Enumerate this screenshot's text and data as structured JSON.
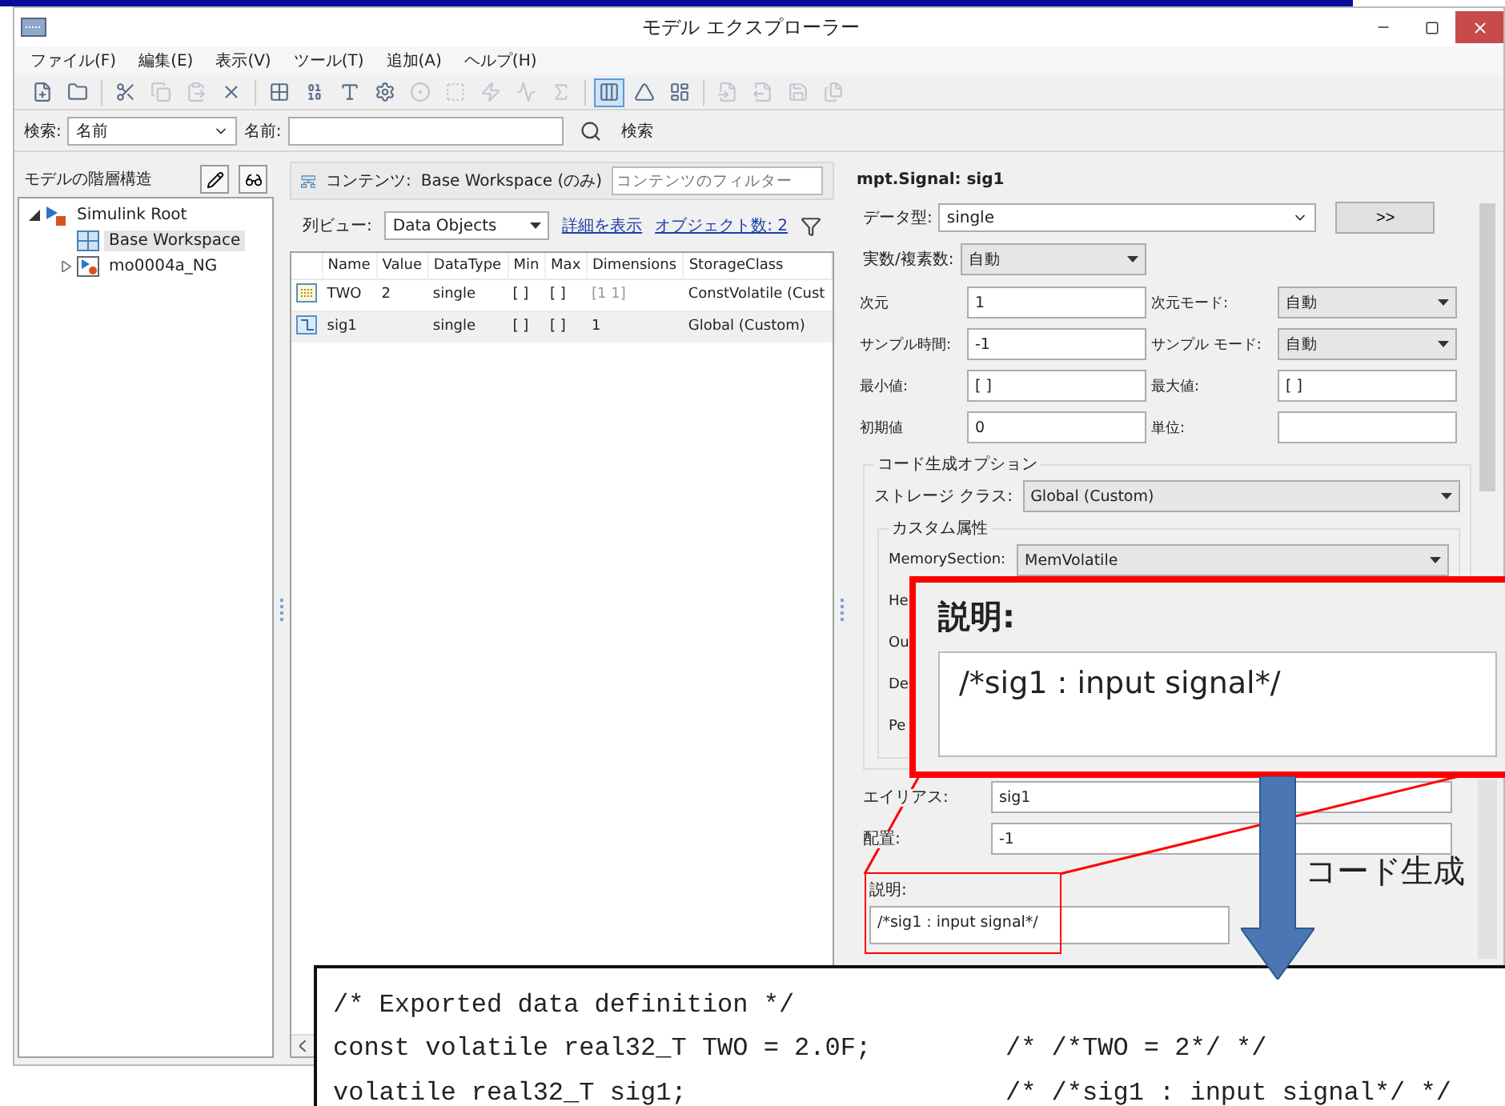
{
  "window": {
    "title": "モデル エクスプローラー"
  },
  "menu": [
    "ファイル(F)",
    "編集(E)",
    "表示(V)",
    "ツール(T)",
    "追加(A)",
    "ヘルプ(H)"
  ],
  "toolbar": [
    {
      "kind": "new",
      "disabled": false,
      "pressed": false
    },
    {
      "kind": "open",
      "disabled": false,
      "pressed": false
    },
    {
      "kind": "separator"
    },
    {
      "kind": "cut",
      "disabled": false,
      "pressed": false
    },
    {
      "kind": "copy",
      "disabled": true,
      "pressed": false
    },
    {
      "kind": "paste",
      "disabled": true,
      "pressed": false
    },
    {
      "kind": "delete",
      "disabled": false,
      "pressed": false
    },
    {
      "kind": "separator"
    },
    {
      "kind": "grid",
      "disabled": false,
      "pressed": false
    },
    {
      "kind": "binary",
      "disabled": false,
      "pressed": false
    },
    {
      "kind": "text",
      "disabled": false,
      "pressed": false
    },
    {
      "kind": "settings",
      "disabled": false,
      "pressed": false
    },
    {
      "kind": "circle",
      "disabled": true,
      "pressed": false
    },
    {
      "kind": "square",
      "disabled": true,
      "pressed": false
    },
    {
      "kind": "zap",
      "disabled": true,
      "pressed": false
    },
    {
      "kind": "pulse",
      "disabled": true,
      "pressed": false
    },
    {
      "kind": "sigma",
      "disabled": true,
      "pressed": false
    },
    {
      "kind": "separator"
    },
    {
      "kind": "columns",
      "disabled": false,
      "pressed": true
    },
    {
      "kind": "triangle",
      "disabled": false,
      "pressed": false
    },
    {
      "kind": "tiles",
      "disabled": false,
      "pressed": false
    },
    {
      "kind": "separator"
    },
    {
      "kind": "import",
      "disabled": true,
      "pressed": false
    },
    {
      "kind": "export",
      "disabled": true,
      "pressed": false
    },
    {
      "kind": "save",
      "disabled": true,
      "pressed": false
    },
    {
      "kind": "files",
      "disabled": true,
      "pressed": false
    }
  ],
  "search_bar": {
    "label": "検索:",
    "mode": "名前",
    "name_label": "名前:",
    "button": "検索"
  },
  "hierarchy": {
    "title": "モデルの階層構造",
    "tree": [
      {
        "label": "Simulink Root",
        "kind": "root",
        "expanded": true,
        "selected": false,
        "children": [
          {
            "label": "Base Workspace",
            "kind": "workspace",
            "selected": true
          },
          {
            "label": "mo0004a_NG",
            "kind": "model",
            "expanded": false,
            "selected": false
          }
        ]
      }
    ]
  },
  "contents": {
    "label": "コンテンツ:",
    "scope": "Base Workspace (のみ)",
    "filter_placeholder": "コンテンツのフィルター",
    "column_view_label": "列ビュー:",
    "column_view": "Data Objects",
    "details_link": "詳細を表示",
    "count_link": "オブジェクト数: 2",
    "table": {
      "columns": [
        "Name",
        "Value",
        "DataType",
        "Min",
        "Max",
        "Dimensions",
        "StorageClass"
      ],
      "rows": [
        {
          "kind": "parameter",
          "selected": false,
          "dimensions_disabled": true,
          "cells": [
            "TWO",
            "2",
            "single",
            "[ ]",
            "[ ]",
            "[1 1]",
            "ConstVolatile (Cust"
          ]
        },
        {
          "kind": "signal",
          "selected": true,
          "dimensions_disabled": false,
          "cells": [
            "sig1",
            "",
            "single",
            "[ ]",
            "[ ]",
            "1",
            "Global (Custom)"
          ]
        }
      ]
    }
  },
  "properties": {
    "title": "mpt.Signal: sig1",
    "data_type": {
      "label": "データ型:",
      "value": "single",
      "button": ">>"
    },
    "complexity": {
      "label": "実数/複素数:",
      "value": "自動"
    },
    "fields": [
      {
        "label": "次元",
        "value": "1",
        "kind": "text"
      },
      {
        "label": "次元モード:",
        "value": "自動",
        "kind": "select"
      },
      {
        "label": "サンプル時間:",
        "value": "-1",
        "kind": "text"
      },
      {
        "label": "サンプル モード:",
        "value": "自動",
        "kind": "select"
      },
      {
        "label": "最小値:",
        "value": "[ ]",
        "kind": "text"
      },
      {
        "label": "最大値:",
        "value": "[ ]",
        "kind": "text"
      },
      {
        "label": "初期値",
        "value": "0",
        "kind": "text"
      },
      {
        "label": "単位:",
        "kind": "text"
      }
    ],
    "code_gen": {
      "title": "コード生成オプション",
      "storage_class_label": "ストレージ クラス:",
      "storage_class": "Global (Custom)",
      "custom": {
        "title": "カスタム属性",
        "rows": [
          {
            "label": "MemorySection:",
            "value": "MemVolatile"
          },
          {
            "label": "He"
          },
          {
            "label": "Ou"
          },
          {
            "label": "De"
          },
          {
            "label": "Pe"
          }
        ]
      }
    },
    "alias": {
      "label": "エイリアス:",
      "value": "sig1"
    },
    "alignment": {
      "label": "配置:",
      "value": "-1"
    },
    "description": {
      "label": "説明:",
      "value": "/*sig1 : input signal*/"
    }
  },
  "callout": {
    "label": "説明:",
    "value": "/*sig1 : input signal*/"
  },
  "arrow_label": "コード生成",
  "code": [
    {
      "code": "/* Exported data definition */"
    },
    {
      "code": "const volatile real32_T TWO = 2.0F;",
      "comment": "/* /*TWO = 2*/ */"
    },
    {
      "code": "volatile real32_T sig1;",
      "comment": "/* /*sig1 : input signal*/ */"
    }
  ]
}
